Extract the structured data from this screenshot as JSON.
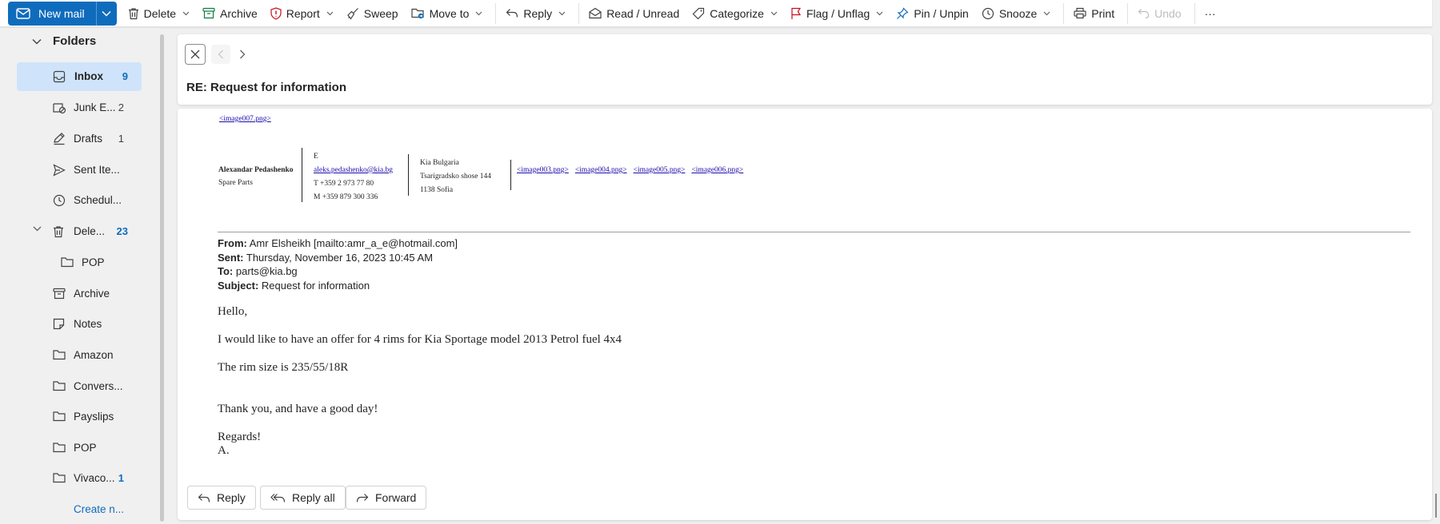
{
  "toolbar": {
    "new_mail": "New mail",
    "delete": "Delete",
    "archive": "Archive",
    "report": "Report",
    "sweep": "Sweep",
    "move_to": "Move to",
    "reply": "Reply",
    "read_unread": "Read / Unread",
    "categorize": "Categorize",
    "flag_unflag": "Flag / Unflag",
    "pin_unpin": "Pin / Unpin",
    "snooze": "Snooze",
    "print": "Print",
    "undo": "Undo",
    "more": "···"
  },
  "folders": {
    "header": "Folders",
    "items": [
      {
        "label": "Inbox",
        "count": "9"
      },
      {
        "label": "Junk E...",
        "count": "2"
      },
      {
        "label": "Drafts",
        "count": "1"
      },
      {
        "label": "Sent Ite...",
        "count": ""
      },
      {
        "label": "Schedul...",
        "count": ""
      },
      {
        "label": "Dele...",
        "count": "23"
      },
      {
        "label": "POP",
        "count": ""
      },
      {
        "label": "Archive",
        "count": ""
      },
      {
        "label": "Notes",
        "count": ""
      },
      {
        "label": "Amazon",
        "count": ""
      },
      {
        "label": "Convers...",
        "count": ""
      },
      {
        "label": "Payslips",
        "count": ""
      },
      {
        "label": "POP",
        "count": ""
      },
      {
        "label": "Vivaco...",
        "count": "1"
      },
      {
        "label": "Create n...",
        "count": ""
      }
    ]
  },
  "reading": {
    "subject": "RE: Request for information"
  },
  "message": {
    "image_top": "<image007.png>",
    "signature": {
      "name": "Alexandar Pedashenko",
      "role": "Spare Parts",
      "email_prefix": "E",
      "email": "aleks.pedashenko@kia.bg",
      "phone": "T +359 2 973 77 80",
      "mobile": "M +359 879 300 336",
      "company": "Kia Bulgaria",
      "street": "Tsarigradsko shose 144",
      "city": "1138 Sofia",
      "images": [
        "<image003.png>",
        "<image004.png>",
        "<image005.png>",
        "<image006.png>"
      ]
    },
    "header": {
      "from_label": "From:",
      "from": "Amr Elsheikh [mailto:amr_a_e@hotmail.com]",
      "sent_label": "Sent:",
      "sent": "Thursday, November 16, 2023 10:45 AM",
      "to_label": "To:",
      "to": "parts@kia.bg",
      "subject_label": "Subject:",
      "subject": "Request for information"
    },
    "body": {
      "greeting": "Hello,",
      "line1": "I would like to have an offer for 4 rims for Kia Sportage model 2013 Petrol fuel 4x4",
      "line2": "The rim size is 235/55/18R",
      "line3": "Thank you, and have a good day!",
      "closing": "Regards!",
      "initial": "A."
    },
    "actions": {
      "reply": "Reply",
      "reply_all": "Reply all",
      "forward": "Forward"
    }
  },
  "colors": {
    "accent": "#0f6cbd",
    "selected_folder": "#cfe4fa",
    "link": "#1a0dab"
  }
}
